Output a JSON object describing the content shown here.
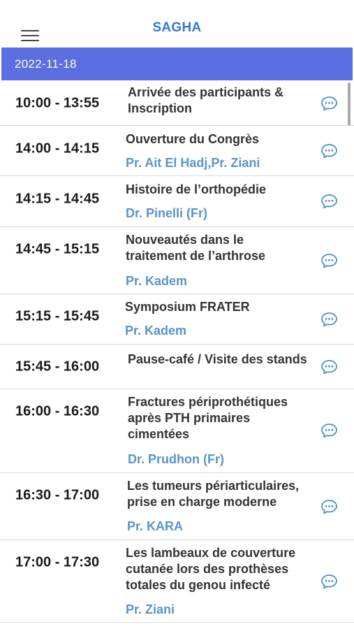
{
  "header": {
    "title": "SAGHA",
    "menu_icon": "hamburger-menu-icon"
  },
  "date": "2022-11-18",
  "colors": {
    "accent": "#5b6fe0",
    "title": "#2f7bd0",
    "speaker": "#5a94c8",
    "icon": "#4a8fcf"
  },
  "sessions": [
    {
      "time": "10:00 - 13:55",
      "title": [
        "Arrivée des participants &",
        "Inscription"
      ],
      "speaker": ""
    },
    {
      "time": "14:00 - 14:15",
      "title": [
        "Ouverture du Congrès"
      ],
      "speaker": "Pr. Ait El Hadj,Pr. Ziani"
    },
    {
      "time": "14:15 - 14:45",
      "title": [
        "Histoire de l’orthopédie"
      ],
      "speaker": "Dr. Pinelli (Fr)"
    },
    {
      "time": "14:45 - 15:15",
      "title": [
        "Nouveautés dans le",
        "traitement de l’arthrose"
      ],
      "speaker": "Pr. Kadem"
    },
    {
      "time": "15:15 - 15:45",
      "title": [
        "Symposium FRATER"
      ],
      "speaker": "Pr. Kadem"
    },
    {
      "time": "15:45 - 16:00",
      "title": [
        "Pause-café / Visite des stands"
      ],
      "speaker": ""
    },
    {
      "time": "16:00 - 16:30",
      "title": [
        "Fractures périprothétiques",
        "après PTH primaires",
        "cimentées"
      ],
      "speaker": "Dr. Prudhon (Fr)"
    },
    {
      "time": "16:30 - 17:00",
      "title": [
        "Les tumeurs périarticulaires,",
        "prise en charge moderne"
      ],
      "speaker": "Pr. KARA"
    },
    {
      "time": "17:00 - 17:30",
      "title": [
        "Les lambeaux de couverture",
        "cutanée lors des prothèses",
        "totales du genou infecté"
      ],
      "speaker": "Pr. Ziani"
    }
  ]
}
